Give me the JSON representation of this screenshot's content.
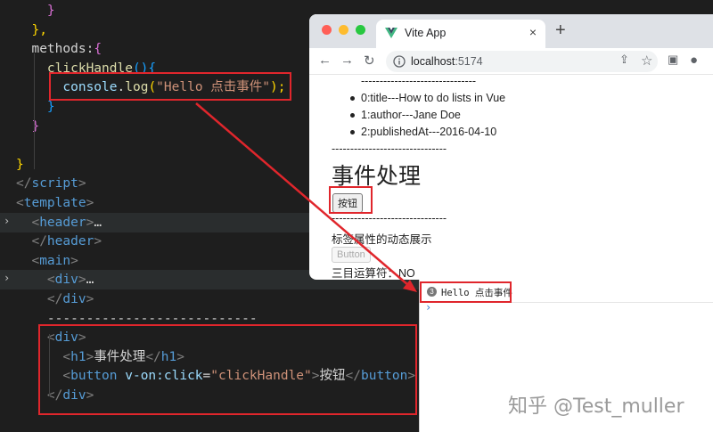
{
  "editor": {
    "lines": [
      {
        "id": "l1",
        "parts": [
          {
            "t": "    }",
            "c": "k-brace"
          }
        ]
      },
      {
        "id": "l2",
        "parts": [
          {
            "t": "  },",
            "c": "k-brace2"
          }
        ]
      },
      {
        "id": "l3",
        "parts": [
          {
            "t": "  methods:",
            "c": "k-prop"
          },
          {
            "t": "{",
            "c": "k-brace"
          }
        ]
      },
      {
        "id": "l4",
        "parts": [
          {
            "t": "    ",
            "c": "k-prop"
          },
          {
            "t": "clickHandle",
            "c": "k-fn"
          },
          {
            "t": "(){",
            "c": "k-brace3"
          }
        ]
      },
      {
        "id": "l5",
        "parts": [
          {
            "t": "      ",
            "c": "k-prop"
          },
          {
            "t": "console",
            "c": "k-obj"
          },
          {
            "t": ".",
            "c": "k-prop"
          },
          {
            "t": "log",
            "c": "k-fn"
          },
          {
            "t": "(",
            "c": "k-brace2"
          },
          {
            "t": "\"Hello 点击事件\"",
            "c": "k-str"
          },
          {
            "t": ");",
            "c": "k-brace2"
          }
        ]
      },
      {
        "id": "l6",
        "parts": [
          {
            "t": "    }",
            "c": "k-brace3"
          }
        ]
      },
      {
        "id": "l7",
        "parts": [
          {
            "t": "  }",
            "c": "k-brace"
          }
        ]
      },
      {
        "id": "l8",
        "parts": [
          {
            "t": "",
            "c": "k-prop"
          }
        ]
      },
      {
        "id": "l9",
        "parts": [
          {
            "t": "}",
            "c": "k-brace2"
          }
        ]
      },
      {
        "id": "l10",
        "parts": [
          {
            "t": "</",
            "c": "k-punc"
          },
          {
            "t": "script",
            "c": "k-tag"
          },
          {
            "t": ">",
            "c": "k-punc"
          }
        ]
      },
      {
        "id": "l11",
        "parts": [
          {
            "t": "<",
            "c": "k-punc"
          },
          {
            "t": "template",
            "c": "k-tag"
          },
          {
            "t": ">",
            "c": "k-punc"
          }
        ]
      },
      {
        "id": "l12",
        "parts": [
          {
            "t": "  <",
            "c": "k-punc"
          },
          {
            "t": "header",
            "c": "k-tag"
          },
          {
            "t": ">",
            "c": "k-punc"
          },
          {
            "t": "…",
            "c": "k-prop"
          }
        ]
      },
      {
        "id": "l13",
        "parts": [
          {
            "t": "  </",
            "c": "k-punc"
          },
          {
            "t": "header",
            "c": "k-tag"
          },
          {
            "t": ">",
            "c": "k-punc"
          }
        ]
      },
      {
        "id": "l14",
        "parts": [
          {
            "t": "  <",
            "c": "k-punc"
          },
          {
            "t": "main",
            "c": "k-tag"
          },
          {
            "t": ">",
            "c": "k-punc"
          }
        ]
      },
      {
        "id": "l15",
        "parts": [
          {
            "t": "    <",
            "c": "k-punc"
          },
          {
            "t": "div",
            "c": "k-tag"
          },
          {
            "t": ">",
            "c": "k-punc"
          },
          {
            "t": "…",
            "c": "k-prop"
          }
        ]
      },
      {
        "id": "l16",
        "parts": [
          {
            "t": "    </",
            "c": "k-punc"
          },
          {
            "t": "div",
            "c": "k-tag"
          },
          {
            "t": ">",
            "c": "k-punc"
          }
        ]
      },
      {
        "id": "l17",
        "parts": [
          {
            "t": "    ---------------------------",
            "c": "k-prop"
          }
        ]
      },
      {
        "id": "l18",
        "parts": [
          {
            "t": "    <",
            "c": "k-punc"
          },
          {
            "t": "div",
            "c": "k-tag"
          },
          {
            "t": ">",
            "c": "k-punc"
          }
        ]
      },
      {
        "id": "l19",
        "parts": [
          {
            "t": "      <",
            "c": "k-punc"
          },
          {
            "t": "h1",
            "c": "k-tag"
          },
          {
            "t": ">",
            "c": "k-punc"
          },
          {
            "t": "事件处理",
            "c": "k-prop"
          },
          {
            "t": "</",
            "c": "k-punc"
          },
          {
            "t": "h1",
            "c": "k-tag"
          },
          {
            "t": ">",
            "c": "k-punc"
          }
        ]
      },
      {
        "id": "l20",
        "parts": [
          {
            "t": "      <",
            "c": "k-punc"
          },
          {
            "t": "button",
            "c": "k-tag"
          },
          {
            "t": " ",
            "c": "k-prop"
          },
          {
            "t": "v-on:click",
            "c": "k-attr"
          },
          {
            "t": "=",
            "c": "k-prop"
          },
          {
            "t": "\"clickHandle\"",
            "c": "k-str"
          },
          {
            "t": ">",
            "c": "k-punc"
          },
          {
            "t": "按钮",
            "c": "k-prop"
          },
          {
            "t": "</",
            "c": "k-punc"
          },
          {
            "t": "button",
            "c": "k-tag"
          },
          {
            "t": ">",
            "c": "k-punc"
          }
        ]
      },
      {
        "id": "l21",
        "parts": [
          {
            "t": "    </",
            "c": "k-punc"
          },
          {
            "t": "div",
            "c": "k-tag"
          },
          {
            "t": ">",
            "c": "k-punc"
          }
        ]
      }
    ]
  },
  "browser": {
    "tab_title": "Vite App",
    "tab_close": "×",
    "new_tab": "+",
    "url_host": "localhost",
    "url_port": ":5174",
    "content": {
      "divider_top": "-------------------------------",
      "list": [
        "0:title---How to do lists in Vue",
        "1:author---Jane Doe",
        "2:publishedAt---2016-04-10"
      ],
      "divider_1": "-------------------------------",
      "heading": "事件处理",
      "button_label": "按钮",
      "divider_2": "-------------------------------",
      "attr_text": "标签属性的动态展示",
      "disabled_button": "Button",
      "ternary_text": "三目运算符：NO"
    }
  },
  "console": {
    "count": "3",
    "message": "Hello 点击事件",
    "prompt": "›"
  },
  "watermark": "知乎 @Test_muller",
  "colors": {
    "highlight": "#e0262c",
    "editor_bg": "#1e1e1e"
  }
}
